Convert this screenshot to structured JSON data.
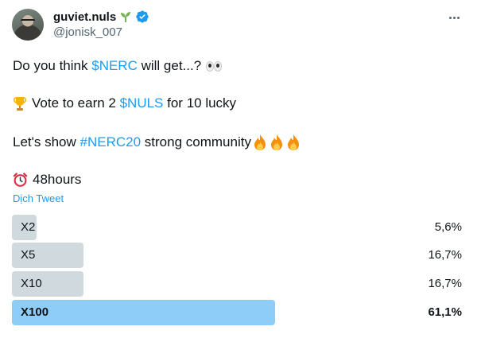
{
  "author": {
    "display_name": "guviet.nuls",
    "handle": "@jonisk_007"
  },
  "tweet": {
    "line1_text": "Do you think ",
    "line1_cashtag": "$NERC",
    "line1_rest": " will get...?",
    "line2_text": "Vote to earn 2 ",
    "line2_cashtag": "$NULS",
    "line2_rest": " for 10 lucky",
    "line3_text": "Let's show ",
    "line3_hashtag": "#NERC20",
    "line3_rest": " strong community",
    "line4_text": "48hours",
    "translate_label": "Dịch Tweet"
  },
  "poll": {
    "options": [
      {
        "label": "X2",
        "percent_text": "5,6%",
        "percent": 5.6
      },
      {
        "label": "X5",
        "percent_text": "16,7%",
        "percent": 16.7
      },
      {
        "label": "X10",
        "percent_text": "16,7%",
        "percent": 16.7
      },
      {
        "label": "X100",
        "percent_text": "61,1%",
        "percent": 61.1
      }
    ],
    "winner_index": 3
  },
  "colors": {
    "accent": "#1d9bf0",
    "verified": "#1d9bf0",
    "poll_bar": "#cfd9de",
    "poll_winner_bar": "#8ecdf8"
  },
  "icons": [
    "sprout-icon",
    "verified-icon",
    "more-icon",
    "eyes-icon",
    "trophy-icon",
    "fire-icon",
    "alarm-clock-icon"
  ]
}
